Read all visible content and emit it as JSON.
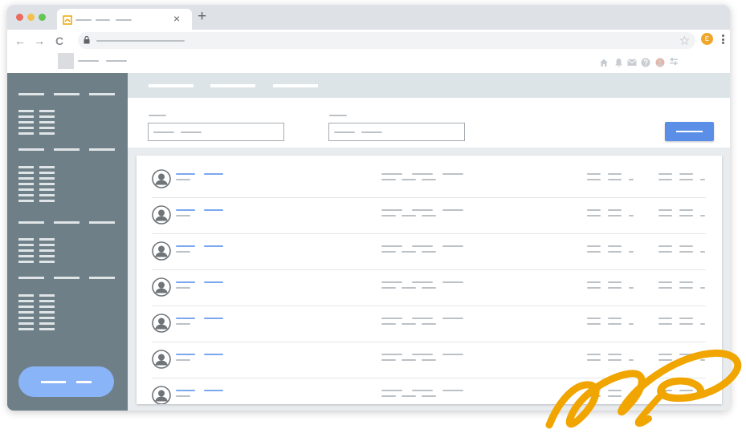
{
  "browser": {
    "window_controls": [
      "close",
      "minimize",
      "maximize"
    ],
    "window_control_colors": [
      "#ed6a5e",
      "#f5bf4f",
      "#62c554"
    ],
    "tab_close_glyph": "×",
    "new_tab_glyph": "+",
    "back_glyph": "←",
    "forward_glyph": "→",
    "reload_glyph": "C",
    "profile_initial": "E",
    "profile_color": "#f0a629"
  },
  "app": {
    "header_icons": [
      "home-icon",
      "bell-icon",
      "mail-icon",
      "help-icon",
      "user-icon",
      "settings-icon"
    ],
    "sidebar_color": "#6e7f87",
    "accent_color": "#5b8ee6",
    "list_row_count": 7
  },
  "brand": {
    "logo_color": "#f0a500"
  }
}
